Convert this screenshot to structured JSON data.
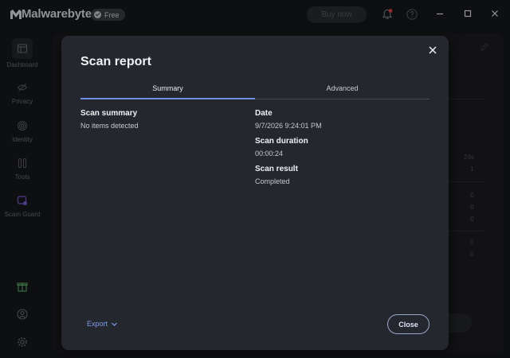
{
  "app": {
    "logo_text": "Malwarebytes",
    "plan_badge": "Free",
    "buy_label": "Buy now"
  },
  "sidebar": {
    "items": [
      {
        "label": "Dashboard",
        "icon": "dashboard-icon"
      },
      {
        "label": "Privacy",
        "icon": "privacy-icon"
      },
      {
        "label": "Identity",
        "icon": "fingerprint-icon"
      },
      {
        "label": "Tools",
        "icon": "tools-icon"
      },
      {
        "label": "Scam Guard",
        "icon": "scam-guard-icon"
      }
    ],
    "bottom_icons": [
      "gift-icon",
      "account-icon",
      "settings-icon"
    ]
  },
  "background": {
    "values": [
      "24s",
      "1",
      "0",
      "0",
      "0",
      "0",
      "0"
    ]
  },
  "modal": {
    "title": "Scan report",
    "tabs": [
      {
        "label": "Summary",
        "active": true
      },
      {
        "label": "Advanced",
        "active": false
      }
    ],
    "scan_summary_label": "Scan summary",
    "scan_summary_value": "No items detected",
    "date_label": "Date",
    "date_value": "9/7/2026 9:24:01 PM",
    "duration_label": "Scan duration",
    "duration_value": "00:00:24",
    "result_label": "Scan result",
    "result_value": "Completed",
    "export_label": "Export",
    "close_label": "Close"
  },
  "colors": {
    "accent": "#6f8fe3",
    "link": "#7c9bea",
    "logo_red": "#e0443e",
    "scam_guard_purple": "#7a5ccf",
    "gift_green": "#5fb46a"
  }
}
